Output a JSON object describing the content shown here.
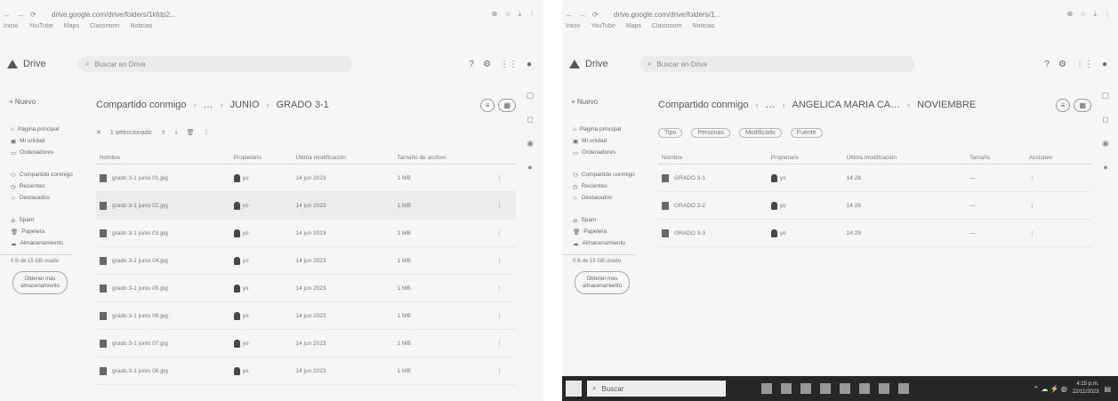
{
  "left": {
    "url": "drive.google.com/drive/folders/1kfdp2...",
    "bookmarks": [
      "Inicio",
      "YouTube",
      "Maps",
      "Classroom",
      "Noticias"
    ],
    "app_name": "Drive",
    "search_placeholder": "Buscar en Drive",
    "new_label": "+ Nuevo",
    "sidebar": [
      "Página principal",
      "Mi unidad",
      "Ordenadores",
      "Compartido conmigo",
      "Recientes",
      "Destacados",
      "Spam",
      "Papelera",
      "Almacenamiento"
    ],
    "storage_text": "0 B de 15 GB usado",
    "storage_button": "Obtener más almacenamiento",
    "breadcrumb": [
      "Compartido conmigo",
      "…",
      "JUNIO",
      "GRADO 3-1"
    ],
    "toolbar": [
      "1 seleccionado"
    ],
    "columns": [
      "Nombre",
      "Propietario",
      "Última modificación",
      "Tamaño de archivo"
    ],
    "rows": [
      {
        "name": "grado 3-1 junio 01.jpg",
        "owner": "yo",
        "modified": "14 jun 2023",
        "size": "1 MB"
      },
      {
        "name": "grado 3-1 junio 02.jpg",
        "owner": "yo",
        "modified": "14 jun 2023",
        "size": "1 MB"
      },
      {
        "name": "grado 3-1 junio 03.jpg",
        "owner": "yo",
        "modified": "14 jun 2023",
        "size": "1 MB"
      },
      {
        "name": "grado 3-1 junio 04.jpg",
        "owner": "yo",
        "modified": "14 jun 2023",
        "size": "1 MB"
      },
      {
        "name": "grado 3-1 junio 05.jpg",
        "owner": "yo",
        "modified": "14 jun 2023",
        "size": "1 MB"
      },
      {
        "name": "grado 3-1 junio 06.jpg",
        "owner": "yo",
        "modified": "14 jun 2023",
        "size": "1 MB"
      },
      {
        "name": "grado 3-1 junio 07.jpg",
        "owner": "yo",
        "modified": "14 jun 2023",
        "size": "1 MB"
      },
      {
        "name": "grado 3-1 junio 08.jpg",
        "owner": "yo",
        "modified": "14 jun 2023",
        "size": "1 MB"
      }
    ]
  },
  "right": {
    "url": "drive.google.com/drive/folders/1...",
    "bookmarks": [
      "Inicio",
      "YouTube",
      "Maps",
      "Classroom",
      "Noticias"
    ],
    "app_name": "Drive",
    "search_placeholder": "Buscar en Drive",
    "new_label": "+ Nuevo",
    "sidebar": [
      "Página principal",
      "Mi unidad",
      "Ordenadores",
      "Compartido conmigo",
      "Recientes",
      "Destacados",
      "Spam",
      "Papelera",
      "Almacenamiento"
    ],
    "storage_text": "0 B de 15 GB usado",
    "storage_button": "Obtener más almacenamiento",
    "breadcrumb": [
      "Compartido conmigo",
      "…",
      "ANGELICA MARIA CA…",
      "NOVIEMBRE"
    ],
    "toolbar": [
      "Tipo",
      "Personas",
      "Modificado",
      "Fuente"
    ],
    "columns": [
      "Nombre",
      "Propietario",
      "Última modificación",
      "Tamaño",
      "Acciones"
    ],
    "rows": [
      {
        "name": "GRADO 3-1",
        "owner": "yo",
        "modified": "14:28",
        "size": "—"
      },
      {
        "name": "GRADO 3-2",
        "owner": "yo",
        "modified": "14:28",
        "size": "—"
      },
      {
        "name": "GRADO 3-3",
        "owner": "yo",
        "modified": "14:29",
        "size": "—"
      }
    ],
    "taskbar_search": "Buscar",
    "clock_time": "4:15 p.m.",
    "clock_date": "22/11/2023"
  }
}
